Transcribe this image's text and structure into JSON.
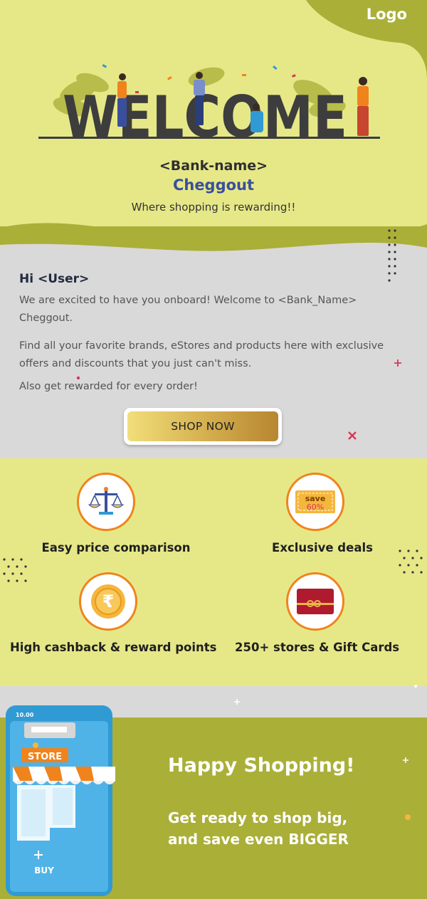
{
  "brand": {
    "logo": "Logo",
    "welcome_art_text": "WELCOME",
    "bank_name": "<Bank-name>",
    "product_name": "Cheggout",
    "tagline": "Where shopping is rewarding!!"
  },
  "greeting": {
    "salutation": "Hi <User>",
    "paragraph1": "We are excited to have you onboard! Welcome to <Bank_Name> Cheggout.",
    "paragraph2": "Find all your favorite brands, eStores and products here with exclusive offers and discounts that you just can't miss.",
    "paragraph3": "Also get rewarded for every order!",
    "cta_label": "SHOP NOW"
  },
  "features": [
    {
      "label": "Easy price comparison",
      "icon": "scale-icon"
    },
    {
      "label": "Exclusive deals",
      "icon": "save-tag-icon",
      "badge_line1": "save",
      "badge_line2": "60%"
    },
    {
      "label": "High cashback & reward points",
      "icon": "rupee-coin-icon"
    },
    {
      "label": "250+ stores & Gift Cards",
      "icon": "gift-card-icon"
    }
  ],
  "footer": {
    "headline": "Happy Shopping!",
    "subline1": "Get ready to shop big,",
    "subline2": "and save even BIGGER",
    "phone_time": "10.00",
    "store_sign": "STORE",
    "buy_label": "BUY"
  },
  "colors": {
    "yellow_bg": "#e6e888",
    "olive": "#aaaf38",
    "grey_bg": "#d9d9d9",
    "accent_orange": "#f0831c",
    "brand_blue": "#3a4f9c"
  }
}
